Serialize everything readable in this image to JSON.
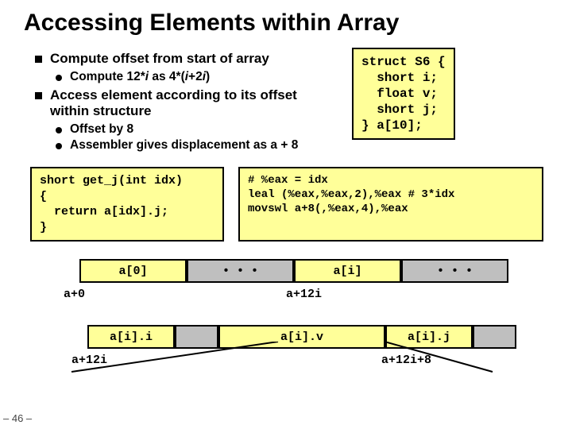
{
  "title": "Accessing Elements within Array",
  "bullets": {
    "b1": "Compute offset from start of array",
    "b1a": "Compute 12*",
    "b1a_i1": "i",
    "b1a_mid": " as 4*(",
    "b1a_i2": "i",
    "b1a_end": "+2",
    "b1a_i3": "i",
    "b1a_close": ")",
    "b2": "Access element according to its offset within structure",
    "b2a": "Offset by 8",
    "b2b": "Assembler gives displacement as a + 8"
  },
  "struct_code": "struct S6 {\n  short i;\n  float v;\n  short j;\n} a[10];",
  "c_code": "short get_j(int idx)\n{\n  return a[idx].j;\n}",
  "asm_code": "# %eax = idx\nleal (%eax,%eax,2),%eax # 3*idx\nmovswl a+8(,%eax,4),%eax",
  "array_row": {
    "c0": "a[0]",
    "dots1": "• • •",
    "ci": "a[i]",
    "dots2": "• • •"
  },
  "array_addr": {
    "left": "a+0",
    "mid": "a+12i"
  },
  "fields_row": {
    "f0": "a[i].i",
    "f1": "a[i].v",
    "f2": "a[i].j"
  },
  "fields_addr": {
    "left": "a+12i",
    "right": "a+12i+8"
  },
  "page": "– 46 –"
}
